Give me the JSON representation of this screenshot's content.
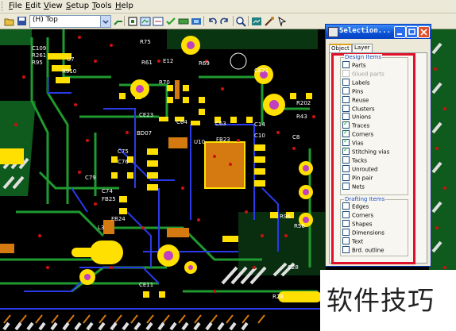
{
  "menu": [
    "File",
    "Edit",
    "View",
    "Setup",
    "Tools",
    "Help"
  ],
  "toolbar": {
    "layer_value": "(H) Top",
    "icons": [
      "open-folder-icon",
      "save-icon",
      "layer-dropdown",
      "route-icon",
      "pin-icon",
      "layers-icon",
      "dimension-icon",
      "check-icon",
      "measure-icon",
      "zoom-icon",
      "undo-icon",
      "redo-icon",
      "zoom-fit-icon",
      "rats-icon",
      "probe-icon",
      "select-icon"
    ]
  },
  "board": {
    "labels": [
      "C109",
      "R261",
      "R95",
      "R910",
      "U7",
      "R75",
      "R61",
      "E12",
      "R70",
      "R69",
      "CE23",
      "C64",
      "C63",
      "CE21",
      "R202",
      "R43",
      "C10",
      "C8",
      "C14",
      "BD07",
      "U10",
      "FB23",
      "C75",
      "C76",
      "C79",
      "C74",
      "FB25",
      "FB24",
      "L3",
      "CE11",
      "R28",
      "R96",
      "R56",
      "C28"
    ],
    "colors": {
      "background": "#000000",
      "traces_green": "#1f7a2a",
      "traces_blue": "#2030d8",
      "pads_yellow": "#ffe000",
      "copper_orange": "#d47a10",
      "vias_red": "#d01010",
      "vias_magenta": "#c040c0"
    }
  },
  "selection": {
    "title": "Selection...",
    "tabs": [
      "Object",
      "Layer"
    ],
    "design_title": "Design Items",
    "design_items": [
      {
        "label": "Parts",
        "checked": false,
        "enabled": true
      },
      {
        "label": "Glued parts",
        "checked": false,
        "enabled": false
      },
      {
        "label": "Labels",
        "checked": false,
        "enabled": true
      },
      {
        "label": "Pins",
        "checked": false,
        "enabled": true
      },
      {
        "label": "Reuse",
        "checked": false,
        "enabled": true
      },
      {
        "label": "Clusters",
        "checked": false,
        "enabled": true
      },
      {
        "label": "Unions",
        "checked": false,
        "enabled": true
      },
      {
        "label": "Traces",
        "checked": true,
        "enabled": true
      },
      {
        "label": "Corners",
        "checked": true,
        "enabled": true
      },
      {
        "label": "Vias",
        "checked": true,
        "enabled": true
      },
      {
        "label": "Stitching vias",
        "checked": true,
        "enabled": true
      },
      {
        "label": "Tacks",
        "checked": false,
        "enabled": true
      },
      {
        "label": "Unrouted",
        "checked": false,
        "enabled": true
      },
      {
        "label": "Pin pair",
        "checked": false,
        "enabled": true
      },
      {
        "label": "Nets",
        "checked": false,
        "enabled": true
      }
    ],
    "drafting_title": "Drafting Items",
    "drafting_items": [
      {
        "label": "Edges",
        "checked": false,
        "enabled": true
      },
      {
        "label": "Corners",
        "checked": false,
        "enabled": true
      },
      {
        "label": "Shapes",
        "checked": false,
        "enabled": true
      },
      {
        "label": "Dimensions",
        "checked": false,
        "enabled": true
      },
      {
        "label": "Text",
        "checked": false,
        "enabled": true
      },
      {
        "label": "Brd. outline",
        "checked": false,
        "enabled": true
      }
    ]
  },
  "watermark": "软件技巧"
}
